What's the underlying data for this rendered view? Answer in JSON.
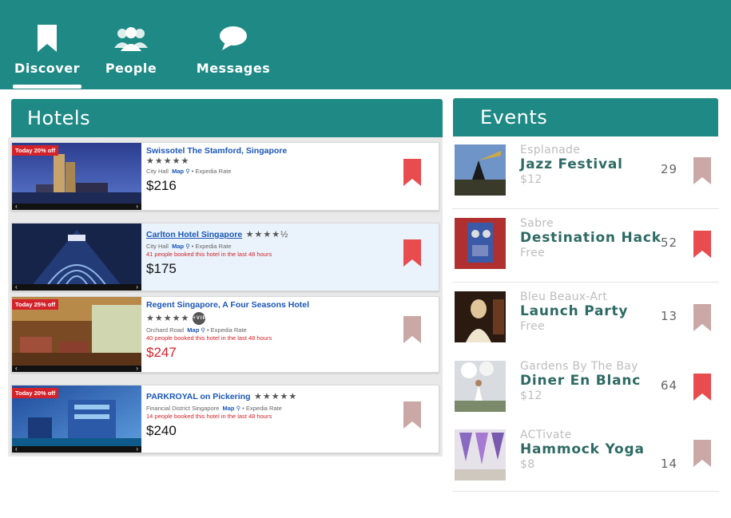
{
  "nav": {
    "items": [
      {
        "label": "Discover",
        "icon": "bookmark-icon",
        "active": true
      },
      {
        "label": "People",
        "icon": "people-icon",
        "active": false
      },
      {
        "label": "Messages",
        "icon": "chat-bubble-icon",
        "active": false
      }
    ]
  },
  "colors": {
    "teal": "#1f8a85",
    "bookmark_active": "#e84c4f",
    "bookmark_inactive": "#c9a8a6"
  },
  "hotels": {
    "title": "Hotels",
    "items": [
      {
        "badge": "Today 20% off",
        "name": "Swissotel The Stamford, Singapore",
        "stars": "★★★★★",
        "area": "City Hall",
        "map": "Map",
        "rate": "• Expedia Rate",
        "booked": "",
        "price": "$216",
        "saved": true
      },
      {
        "badge": "",
        "name": "Carlton Hotel Singapore",
        "stars": "★★★★½",
        "area": "City Hall",
        "map": "Map",
        "rate": "• Expedia Rate",
        "booked": "41 people booked this hotel in the last 48 hours",
        "price": "$175",
        "saved": true
      },
      {
        "badge": "Today 25% off",
        "name": "Regent Singapore, A Four Seasons Hotel",
        "stars": "★★★★★",
        "vip": "+VIP",
        "area": "Orchard Road",
        "map": "Map",
        "rate": "• Expedia Rate",
        "booked": "40 people booked this hotel in the last 48 hours",
        "price": "$247",
        "saved": false
      },
      {
        "badge": "Today 20% off",
        "name": "PARKROYAL on Pickering",
        "stars": "★★★★★",
        "area": "Financial District Singapore",
        "map": "Map",
        "rate": "• Expedia Rate",
        "booked": "14 people booked this hotel in the last 48 hours",
        "price": "$240",
        "saved": false
      }
    ]
  },
  "events": {
    "title": "Events",
    "items": [
      {
        "venue": "Esplanade",
        "title": "Jazz Festival",
        "cost": "$12",
        "count": "29",
        "saved": false
      },
      {
        "venue": "Sabre",
        "title": "Destination Hack",
        "cost": "Free",
        "count": "52",
        "saved": true
      },
      {
        "venue": "Bleu Beaux-Art",
        "title": "Launch Party",
        "cost": "Free",
        "count": "13",
        "saved": false
      },
      {
        "venue": "Gardens By The Bay",
        "title": "Diner En Blanc",
        "cost": "$12",
        "count": "64",
        "saved": true
      },
      {
        "venue": "ACTivate",
        "title": "Hammock Yoga",
        "cost": "$8",
        "count": "14",
        "saved": false
      }
    ]
  }
}
